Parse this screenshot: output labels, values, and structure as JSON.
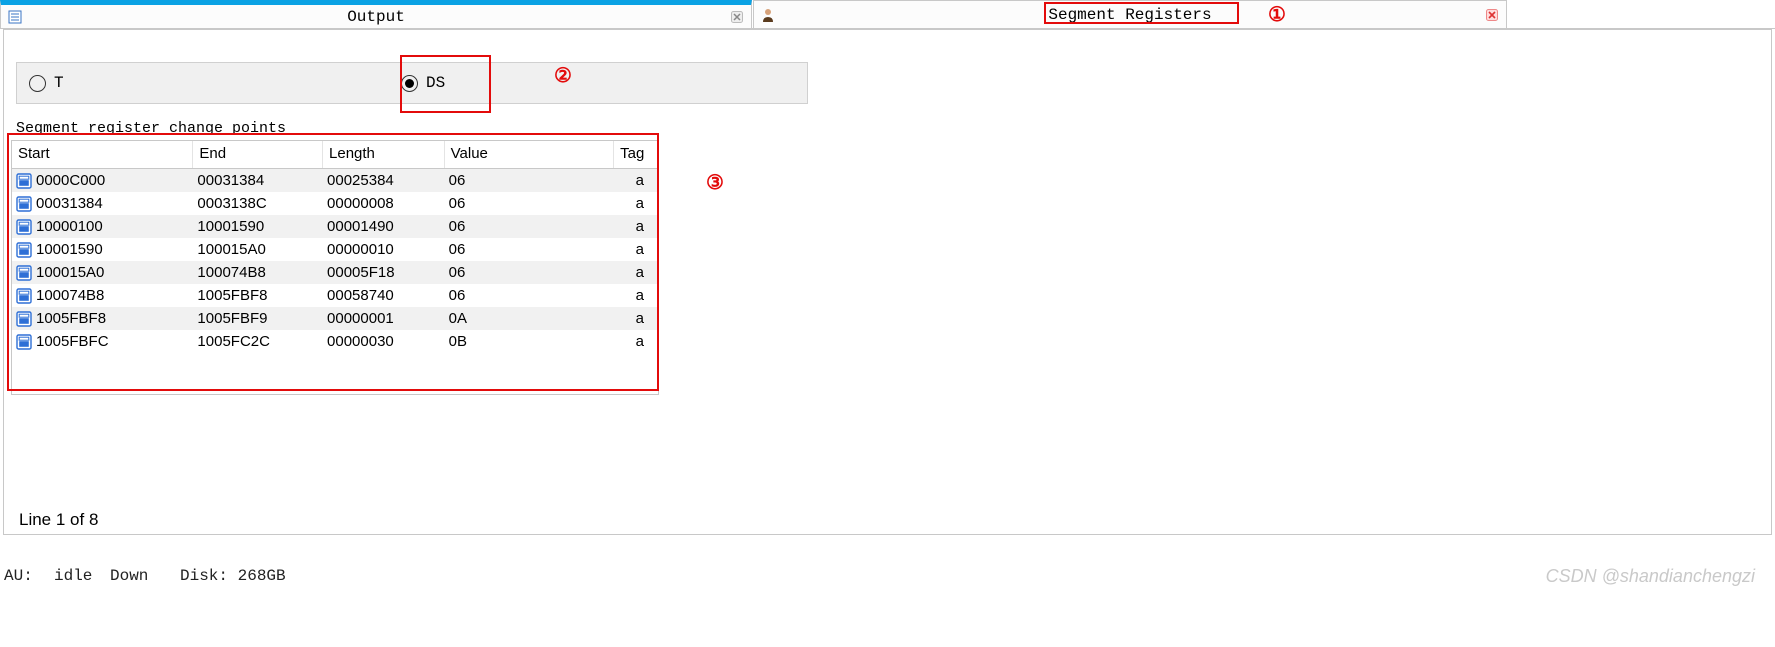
{
  "tabs": {
    "output": {
      "title": "Output"
    },
    "segreg": {
      "title": "Segment Registers"
    }
  },
  "annotations": {
    "one": "①",
    "two": "②",
    "three": "③"
  },
  "radios": {
    "t": {
      "label": "T",
      "selected": false
    },
    "ds": {
      "label": "DS",
      "selected": true
    }
  },
  "section_label": "Segment register change points",
  "table": {
    "headers": {
      "start": "Start",
      "end": "End",
      "length": "Length",
      "value": "Value",
      "tag": "Tag"
    },
    "rows": [
      {
        "start": "0000C000",
        "end": "00031384",
        "length": "00025384",
        "value": "06",
        "tag": "a"
      },
      {
        "start": "00031384",
        "end": "0003138C",
        "length": "00000008",
        "value": "06",
        "tag": "a"
      },
      {
        "start": "10000100",
        "end": "10001590",
        "length": "00001490",
        "value": "06",
        "tag": "a"
      },
      {
        "start": "10001590",
        "end": "100015A0",
        "length": "00000010",
        "value": "06",
        "tag": "a"
      },
      {
        "start": "100015A0",
        "end": "100074B8",
        "length": "00005F18",
        "value": "06",
        "tag": "a"
      },
      {
        "start": "100074B8",
        "end": "1005FBF8",
        "length": "00058740",
        "value": "06",
        "tag": "a"
      },
      {
        "start": "1005FBF8",
        "end": "1005FBF9",
        "length": "00000001",
        "value": "0A",
        "tag": "a"
      },
      {
        "start": "1005FBFC",
        "end": "1005FC2C",
        "length": "00000030",
        "value": "0B",
        "tag": "a"
      }
    ]
  },
  "status": {
    "line_of": "Line 1 of 8",
    "au": "AU:",
    "idle": "idle",
    "down": "Down",
    "disk": "Disk: 268GB"
  },
  "watermark": "CSDN @shandianchengzi"
}
